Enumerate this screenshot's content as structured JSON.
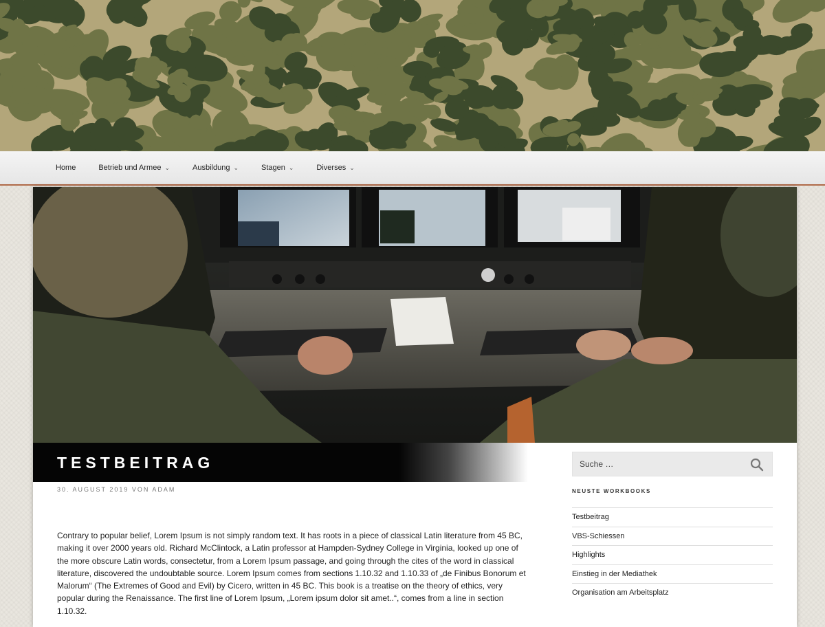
{
  "colors": {
    "camo_sand": "#b3a67a",
    "camo_olive": "#6f7446",
    "camo_dark": "#3c4a2c",
    "nav_border": "#b06a48",
    "title_bar": "#050505"
  },
  "nav": {
    "items": [
      {
        "label": "Home",
        "has_dropdown": false
      },
      {
        "label": "Betrieb und Armee",
        "has_dropdown": true
      },
      {
        "label": "Ausbildung",
        "has_dropdown": true
      },
      {
        "label": "Stagen",
        "has_dropdown": true
      },
      {
        "label": "Diverses",
        "has_dropdown": true
      }
    ],
    "chevron": "⌄"
  },
  "post": {
    "title": "TESTBEITRAG",
    "meta": "30. AUGUST 2019 VON ADAM",
    "content": "Contrary to popular belief, Lorem Ipsum is not simply random text. It has roots in a piece of classical Latin literature from 45 BC, making it over 2000 years old. Richard McClintock, a Latin professor at Hampden-Sydney College in Virginia, looked up one of the more obscure Latin words, consectetur, from a Lorem Ipsum passage, and going through the cites of the word in classical literature, discovered the undoubtable source. Lorem Ipsum comes from sections 1.10.32 and 1.10.33 of „de Finibus Bonorum et Malorum“ (The Extremes of Good and Evil) by Cicero, written in 45 BC. This book is a treatise on the theory of ethics, very popular during the Renaissance. The first line of Lorem Ipsum, „Lorem ipsum dolor sit amet..“, comes from a line in section 1.10.32."
  },
  "sidebar": {
    "search": {
      "placeholder": "Suche …",
      "icon": "search-icon"
    },
    "widget_title": "NEUSTE WORKBOOKS",
    "items": [
      {
        "label": "Testbeitrag"
      },
      {
        "label": "VBS-Schiessen"
      },
      {
        "label": "Highlights"
      },
      {
        "label": "Einstieg in der Mediathek"
      },
      {
        "label": "Organisation am Arbeitsplatz"
      }
    ]
  },
  "hero_image": {
    "icon": "cockpit-console-photo"
  }
}
